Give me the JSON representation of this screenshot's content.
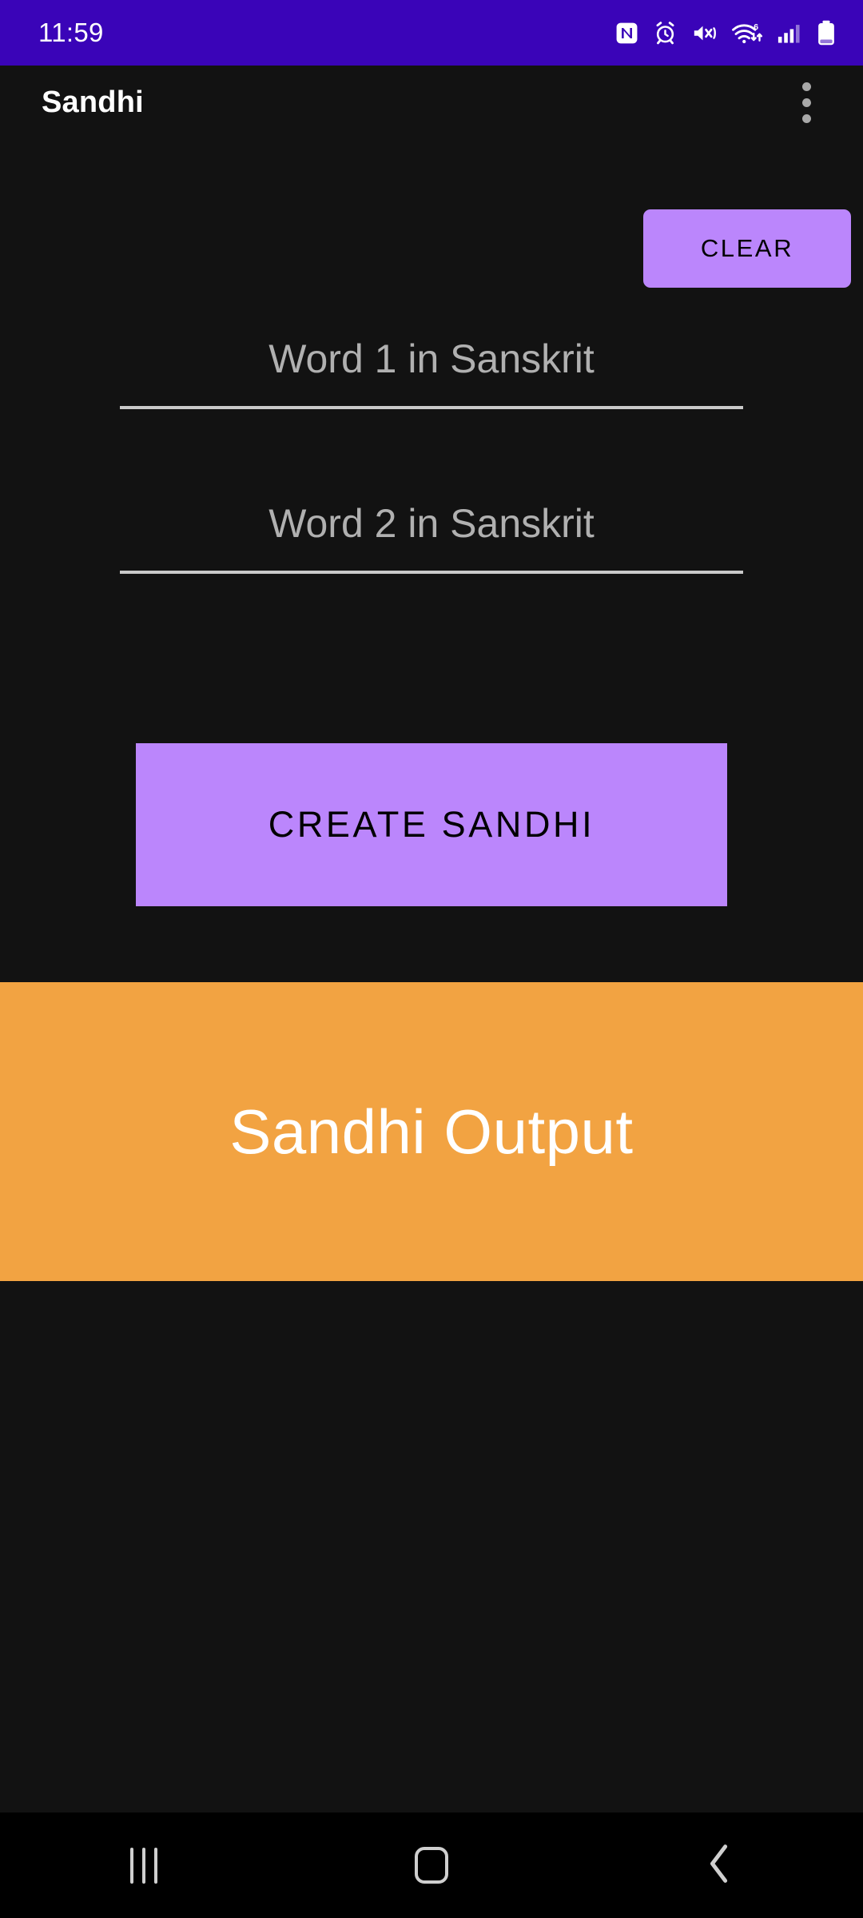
{
  "status_bar": {
    "clock": "11:59",
    "background_color": "#3a04b8",
    "icons": [
      {
        "name": "nfc-icon",
        "label": "NFC"
      },
      {
        "name": "alarm-icon",
        "label": "Alarm"
      },
      {
        "name": "mute-vibrate-icon",
        "label": "Sound off"
      },
      {
        "name": "wifi-6-icon",
        "label": "Wi-Fi 6"
      },
      {
        "name": "cellular-signal-icon",
        "label": "Signal"
      },
      {
        "name": "battery-icon",
        "label": "Battery"
      }
    ]
  },
  "app_bar": {
    "title": "Sandhi",
    "overflow_menu_name": "More options"
  },
  "main": {
    "clear_label": "CLEAR",
    "word1": {
      "value": "",
      "placeholder": "Word 1 in Sanskrit"
    },
    "word2": {
      "value": "",
      "placeholder": "Word 2 in Sanskrit"
    },
    "create_label": "CREATE SANDHI",
    "output_text": "Sandhi Output",
    "accent_color": "#bb86fc",
    "output_background_color": "#f2a342",
    "page_background_color": "#121212"
  },
  "nav_bar": {
    "recents_label": "Recents",
    "home_label": "Home",
    "back_label": "Back"
  }
}
